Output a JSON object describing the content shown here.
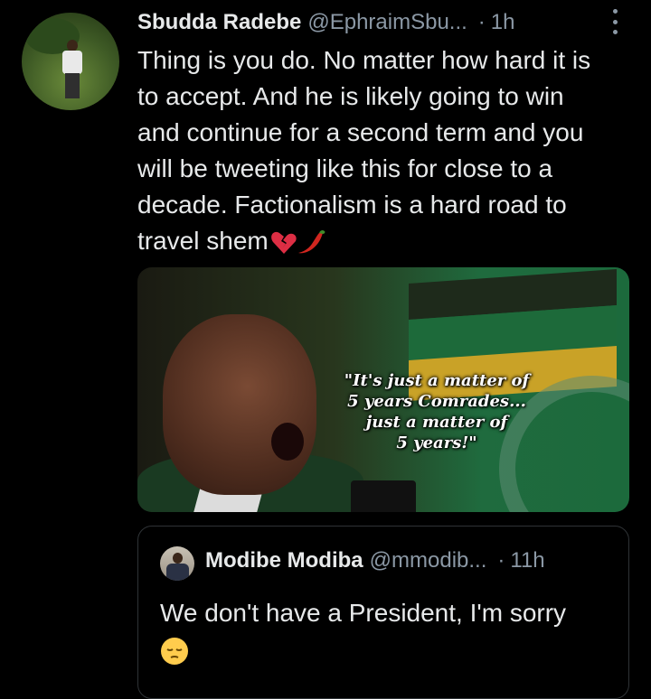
{
  "tweet": {
    "author_name": "Sbudda Radebe",
    "author_handle": "@EphraimSbu...",
    "separator": "·",
    "time": "1h",
    "text_lines": [
      "Thing is you do. No matter how hard it is",
      "to accept. And he is likely going to win",
      "and continue for a second term and you",
      "will be tweeting like this for close to a",
      "decade. Factionalism is a hard road to",
      "travel shem"
    ],
    "emoji_icons": [
      "broken-heart-icon",
      "chili-pepper-icon"
    ],
    "more_icon": "more-vertical-icon"
  },
  "media": {
    "caption_lines": [
      "\"It's just a matter of",
      "5 years Comrades...",
      "just a matter of",
      "5 years!\""
    ]
  },
  "quoted_tweet": {
    "author_name": "Modibe Modiba",
    "author_handle": "@mmodib...",
    "separator": "·",
    "time": "11h",
    "text_lines": [
      "We don't have a President,  I'm sorry"
    ],
    "emoji_icon": "pensive-face-icon"
  },
  "colors": {
    "background": "#000000",
    "primary_text": "#e7e9ea",
    "secondary_text": "#8b98a5",
    "border": "#2f3336"
  }
}
